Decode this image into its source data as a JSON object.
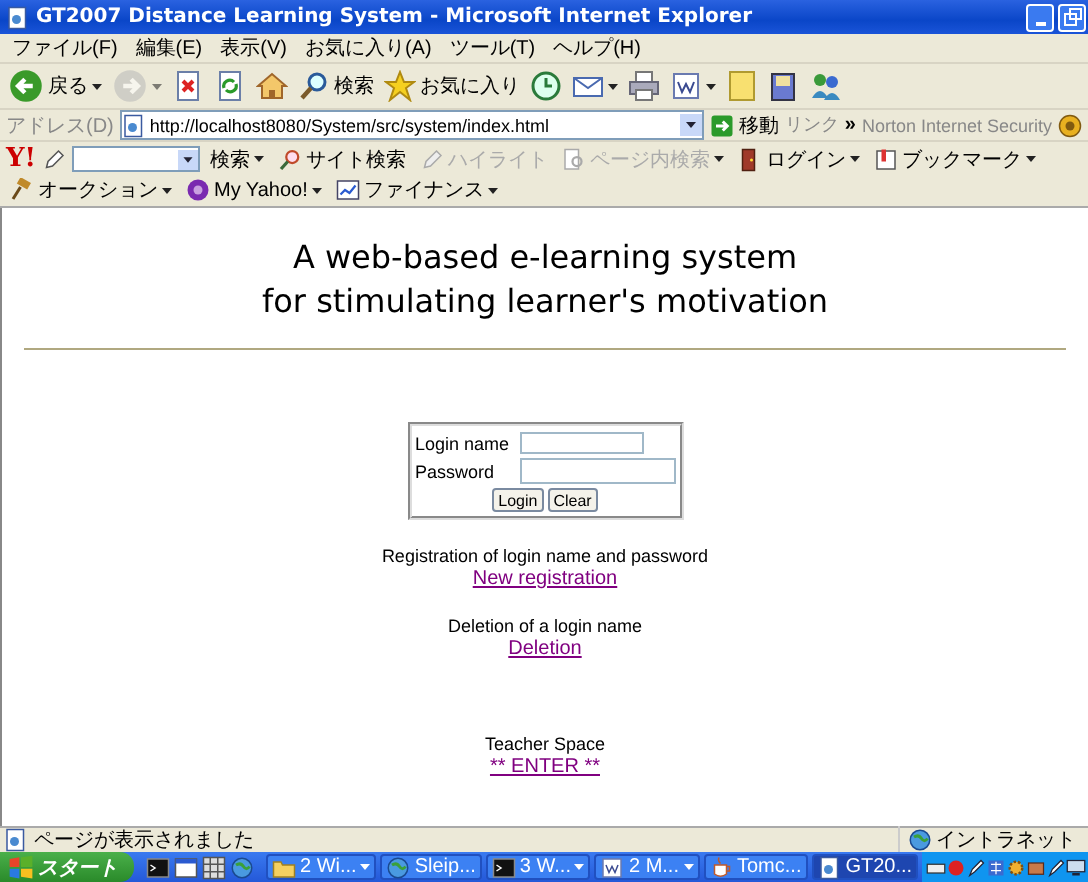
{
  "window": {
    "title": "GT2007 Distance Learning System - Microsoft Internet Explorer"
  },
  "menu": [
    "ファイル(F)",
    "編集(E)",
    "表示(V)",
    "お気に入り(A)",
    "ツール(T)",
    "ヘルプ(H)"
  ],
  "toolbar": [
    {
      "kind": "back",
      "label": "戻る",
      "dropdown": true,
      "disabled": false
    },
    {
      "kind": "forward",
      "dropdown": true,
      "disabled": true
    },
    {
      "kind": "stop",
      "disabled": false
    },
    {
      "kind": "refresh",
      "disabled": false
    },
    {
      "kind": "home",
      "disabled": false
    },
    {
      "kind": "search",
      "label": "検索",
      "disabled": false
    },
    {
      "kind": "favorites",
      "label": "お気に入り",
      "disabled": false
    },
    {
      "kind": "history",
      "disabled": false
    },
    {
      "kind": "mail",
      "dropdown": true,
      "disabled": false
    },
    {
      "kind": "print",
      "disabled": false
    },
    {
      "kind": "word",
      "dropdown": true,
      "disabled": false
    },
    {
      "kind": "note",
      "disabled": false
    },
    {
      "kind": "research",
      "disabled": false
    },
    {
      "kind": "messenger",
      "disabled": false
    }
  ],
  "address_bar": {
    "label": "アドレス(D)",
    "url": "http://localhost8080/System/src/system/index.html",
    "go": "移動",
    "links": "リンク",
    "more": "»",
    "extra": "Norton Internet Security"
  },
  "yahoo_toolbar": {
    "logo": "Y!",
    "items": [
      {
        "kind": "search",
        "label": "検索",
        "dropdown": true,
        "disabled": false
      },
      {
        "kind": "site",
        "label": "サイト検索",
        "disabled": false
      },
      {
        "kind": "highlight",
        "label": "ハイライト",
        "disabled": true
      },
      {
        "kind": "pagesearch",
        "label": "ページ内検索",
        "dropdown": true,
        "disabled": true
      },
      {
        "kind": "login",
        "label": "ログイン",
        "dropdown": true,
        "disabled": false
      },
      {
        "kind": "bookmark",
        "label": "ブックマーク",
        "dropdown": true,
        "disabled": false
      },
      {
        "kind": "auction",
        "label": "オークション",
        "dropdown": true,
        "disabled": false
      },
      {
        "kind": "myyahoo",
        "label": "My Yahoo!",
        "dropdown": true,
        "disabled": false
      },
      {
        "kind": "finance",
        "label": "ファイナンス",
        "dropdown": true,
        "disabled": false
      }
    ]
  },
  "page": {
    "heading": [
      "A web-based e-learning system",
      "for stimulating learner's motivation"
    ],
    "login_form": {
      "fields": [
        {
          "label": "Login name"
        },
        {
          "label": "Password"
        }
      ],
      "buttons": [
        "Login",
        "Clear"
      ]
    },
    "sections": [
      {
        "caption": "Registration of login name and password",
        "link": "New registration"
      },
      {
        "caption": "Deletion of a login name",
        "link": "Deletion"
      },
      {
        "caption": "Teacher Space",
        "link": "** ENTER **"
      }
    ]
  },
  "status_bar": {
    "text": "ページが表示されました",
    "zone": "イントラネット"
  },
  "taskbar": {
    "start": "スタート",
    "tasks": [
      {
        "kind": "folder",
        "label": "2 Wi...",
        "dropdown": true,
        "selected": false
      },
      {
        "kind": "globe",
        "label": "Sleip...",
        "dropdown": false,
        "selected": false
      },
      {
        "kind": "console",
        "label": "3 W...",
        "dropdown": true,
        "selected": false
      },
      {
        "kind": "word",
        "label": "2 M...",
        "dropdown": true,
        "selected": false
      },
      {
        "kind": "cup",
        "label": "Tomc...",
        "dropdown": false,
        "selected": false
      },
      {
        "kind": "ie",
        "label": "GT20...",
        "dropdown": false,
        "selected": true
      }
    ]
  }
}
